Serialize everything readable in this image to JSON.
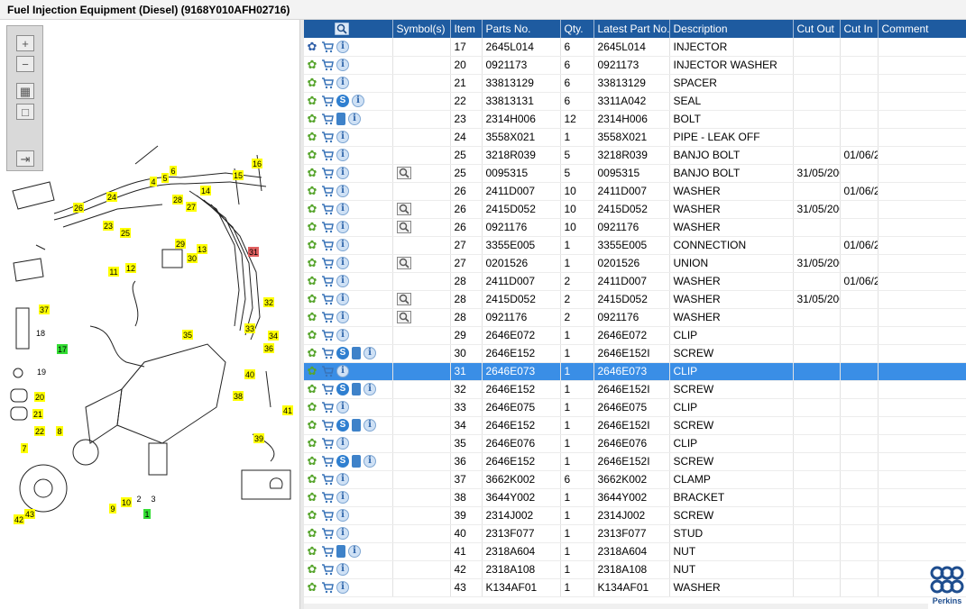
{
  "window": {
    "title": "Fuel Injection Equipment (Diesel) (9168Y010AFH02716)"
  },
  "toolbar": {
    "zoom_in_icon": "plus-icon",
    "zoom_out_icon": "minus-icon",
    "fit_icon": "grid-icon",
    "reset_icon": "square-icon",
    "export_icon": "export-icon"
  },
  "diagram": {
    "callouts": [
      {
        "label": "4"
      },
      {
        "label": "5"
      },
      {
        "label": "6"
      },
      {
        "label": "16"
      },
      {
        "label": "15"
      },
      {
        "label": "14"
      },
      {
        "label": "24"
      },
      {
        "label": "28"
      },
      {
        "label": "27"
      },
      {
        "label": "26"
      },
      {
        "label": "23"
      },
      {
        "label": "25"
      },
      {
        "label": "29"
      },
      {
        "label": "13"
      },
      {
        "label": "30"
      },
      {
        "label": "12"
      },
      {
        "label": "11"
      },
      {
        "label": "31"
      },
      {
        "label": "32"
      },
      {
        "label": "33"
      },
      {
        "label": "34"
      },
      {
        "label": "35"
      },
      {
        "label": "36"
      },
      {
        "label": "37"
      },
      {
        "label": "18"
      },
      {
        "label": "17"
      },
      {
        "label": "19"
      },
      {
        "label": "20"
      },
      {
        "label": "21"
      },
      {
        "label": "22"
      },
      {
        "label": "8"
      },
      {
        "label": "7"
      },
      {
        "label": "40"
      },
      {
        "label": "38"
      },
      {
        "label": "41"
      },
      {
        "label": "39"
      },
      {
        "label": "9"
      },
      {
        "label": "10"
      },
      {
        "label": "2"
      },
      {
        "label": "3"
      },
      {
        "label": "1"
      },
      {
        "label": "43"
      },
      {
        "label": "42"
      }
    ],
    "highlighted_callout": "31"
  },
  "grid": {
    "columns": [
      "",
      "Symbol(s)",
      "Item",
      "Parts No.",
      "Qty.",
      "Latest Part No.",
      "Description",
      "Cut Out",
      "Cut In",
      "Comment"
    ],
    "header_icon": "magnifier-icon",
    "rows": [
      {
        "icons": [
          "gear-blue",
          "cart",
          "info"
        ],
        "symbol": "",
        "item": "17",
        "part": "2645L014",
        "qty": "6",
        "latest": "2645L014",
        "desc": "INJECTOR",
        "cut_out": "",
        "cut_in": "",
        "comment": ""
      },
      {
        "icons": [
          "gear",
          "cart",
          "info"
        ],
        "symbol": "",
        "item": "20",
        "part": "0921173",
        "qty": "6",
        "latest": "0921173",
        "desc": "INJECTOR WASHER",
        "cut_out": "",
        "cut_in": "",
        "comment": ""
      },
      {
        "icons": [
          "gear",
          "cart",
          "info"
        ],
        "symbol": "",
        "item": "21",
        "part": "33813129",
        "qty": "6",
        "latest": "33813129",
        "desc": "SPACER",
        "cut_out": "",
        "cut_in": "",
        "comment": ""
      },
      {
        "icons": [
          "gear",
          "cart",
          "s",
          "info"
        ],
        "symbol": "",
        "item": "22",
        "part": "33813131",
        "qty": "6",
        "latest": "3311A042",
        "desc": "SEAL",
        "cut_out": "",
        "cut_in": "",
        "comment": ""
      },
      {
        "icons": [
          "gear",
          "cart",
          "book",
          "info"
        ],
        "symbol": "",
        "item": "23",
        "part": "2314H006",
        "qty": "12",
        "latest": "2314H006",
        "desc": "BOLT",
        "cut_out": "",
        "cut_in": "",
        "comment": ""
      },
      {
        "icons": [
          "gear",
          "cart",
          "info"
        ],
        "symbol": "",
        "item": "24",
        "part": "3558X021",
        "qty": "1",
        "latest": "3558X021",
        "desc": "PIPE - LEAK OFF",
        "cut_out": "",
        "cut_in": "",
        "comment": ""
      },
      {
        "icons": [
          "gear",
          "cart",
          "info"
        ],
        "symbol": "",
        "item": "25",
        "part": "3218R039",
        "qty": "5",
        "latest": "3218R039",
        "desc": "BANJO BOLT",
        "cut_out": "",
        "cut_in": "01/06/2",
        "comment": ""
      },
      {
        "icons": [
          "gear",
          "cart",
          "info"
        ],
        "symbol": "mag",
        "item": "25",
        "part": "0095315",
        "qty": "5",
        "latest": "0095315",
        "desc": "BANJO BOLT",
        "cut_out": "31/05/200",
        "cut_in": "",
        "comment": ""
      },
      {
        "icons": [
          "gear",
          "cart",
          "info"
        ],
        "symbol": "",
        "item": "26",
        "part": "2411D007",
        "qty": "10",
        "latest": "2411D007",
        "desc": "WASHER",
        "cut_out": "",
        "cut_in": "01/06/2",
        "comment": ""
      },
      {
        "icons": [
          "gear",
          "cart",
          "info"
        ],
        "symbol": "mag",
        "item": "26",
        "part": "2415D052",
        "qty": "10",
        "latest": "2415D052",
        "desc": "WASHER",
        "cut_out": "31/05/200",
        "cut_in": "",
        "comment": ""
      },
      {
        "icons": [
          "gear",
          "cart",
          "info"
        ],
        "symbol": "mag",
        "item": "26",
        "part": "0921176",
        "qty": "10",
        "latest": "0921176",
        "desc": "WASHER",
        "cut_out": "",
        "cut_in": "",
        "comment": ""
      },
      {
        "icons": [
          "gear",
          "cart",
          "info"
        ],
        "symbol": "",
        "item": "27",
        "part": "3355E005",
        "qty": "1",
        "latest": "3355E005",
        "desc": "CONNECTION",
        "cut_out": "",
        "cut_in": "01/06/2",
        "comment": ""
      },
      {
        "icons": [
          "gear",
          "cart",
          "info"
        ],
        "symbol": "mag",
        "item": "27",
        "part": "0201526",
        "qty": "1",
        "latest": "0201526",
        "desc": "UNION",
        "cut_out": "31/05/200",
        "cut_in": "",
        "comment": ""
      },
      {
        "icons": [
          "gear",
          "cart",
          "info"
        ],
        "symbol": "",
        "item": "28",
        "part": "2411D007",
        "qty": "2",
        "latest": "2411D007",
        "desc": "WASHER",
        "cut_out": "",
        "cut_in": "01/06/2",
        "comment": ""
      },
      {
        "icons": [
          "gear",
          "cart",
          "info"
        ],
        "symbol": "mag",
        "item": "28",
        "part": "2415D052",
        "qty": "2",
        "latest": "2415D052",
        "desc": "WASHER",
        "cut_out": "31/05/200",
        "cut_in": "",
        "comment": ""
      },
      {
        "icons": [
          "gear",
          "cart",
          "info"
        ],
        "symbol": "mag",
        "item": "28",
        "part": "0921176",
        "qty": "2",
        "latest": "0921176",
        "desc": "WASHER",
        "cut_out": "",
        "cut_in": "",
        "comment": ""
      },
      {
        "icons": [
          "gear",
          "cart",
          "info"
        ],
        "symbol": "",
        "item": "29",
        "part": "2646E072",
        "qty": "1",
        "latest": "2646E072",
        "desc": "CLIP",
        "cut_out": "",
        "cut_in": "",
        "comment": ""
      },
      {
        "icons": [
          "gear",
          "cart",
          "s",
          "book",
          "info"
        ],
        "symbol": "",
        "item": "30",
        "part": "2646E152",
        "qty": "1",
        "latest": "2646E152I",
        "desc": "SCREW",
        "cut_out": "",
        "cut_in": "",
        "comment": ""
      },
      {
        "icons": [
          "gear",
          "cart",
          "info"
        ],
        "symbol": "",
        "item": "31",
        "part": "2646E073",
        "qty": "1",
        "latest": "2646E073",
        "desc": "CLIP",
        "cut_out": "",
        "cut_in": "",
        "comment": "",
        "selected": true
      },
      {
        "icons": [
          "gear",
          "cart",
          "s",
          "book",
          "info"
        ],
        "symbol": "",
        "item": "32",
        "part": "2646E152",
        "qty": "1",
        "latest": "2646E152I",
        "desc": "SCREW",
        "cut_out": "",
        "cut_in": "",
        "comment": ""
      },
      {
        "icons": [
          "gear",
          "cart",
          "info"
        ],
        "symbol": "",
        "item": "33",
        "part": "2646E075",
        "qty": "1",
        "latest": "2646E075",
        "desc": "CLIP",
        "cut_out": "",
        "cut_in": "",
        "comment": ""
      },
      {
        "icons": [
          "gear",
          "cart",
          "s",
          "book",
          "info"
        ],
        "symbol": "",
        "item": "34",
        "part": "2646E152",
        "qty": "1",
        "latest": "2646E152I",
        "desc": "SCREW",
        "cut_out": "",
        "cut_in": "",
        "comment": ""
      },
      {
        "icons": [
          "gear",
          "cart",
          "info"
        ],
        "symbol": "",
        "item": "35",
        "part": "2646E076",
        "qty": "1",
        "latest": "2646E076",
        "desc": "CLIP",
        "cut_out": "",
        "cut_in": "",
        "comment": ""
      },
      {
        "icons": [
          "gear",
          "cart",
          "s",
          "book",
          "info"
        ],
        "symbol": "",
        "item": "36",
        "part": "2646E152",
        "qty": "1",
        "latest": "2646E152I",
        "desc": "SCREW",
        "cut_out": "",
        "cut_in": "",
        "comment": ""
      },
      {
        "icons": [
          "gear",
          "cart",
          "info"
        ],
        "symbol": "",
        "item": "37",
        "part": "3662K002",
        "qty": "6",
        "latest": "3662K002",
        "desc": "CLAMP",
        "cut_out": "",
        "cut_in": "",
        "comment": ""
      },
      {
        "icons": [
          "gear",
          "cart",
          "info"
        ],
        "symbol": "",
        "item": "38",
        "part": "3644Y002",
        "qty": "1",
        "latest": "3644Y002",
        "desc": "BRACKET",
        "cut_out": "",
        "cut_in": "",
        "comment": ""
      },
      {
        "icons": [
          "gear",
          "cart",
          "info"
        ],
        "symbol": "",
        "item": "39",
        "part": "2314J002",
        "qty": "1",
        "latest": "2314J002",
        "desc": "SCREW",
        "cut_out": "",
        "cut_in": "",
        "comment": ""
      },
      {
        "icons": [
          "gear",
          "cart",
          "info"
        ],
        "symbol": "",
        "item": "40",
        "part": "2313F077",
        "qty": "1",
        "latest": "2313F077",
        "desc": "STUD",
        "cut_out": "",
        "cut_in": "",
        "comment": ""
      },
      {
        "icons": [
          "gear",
          "cart",
          "book",
          "info"
        ],
        "symbol": "",
        "item": "41",
        "part": "2318A604",
        "qty": "1",
        "latest": "2318A604",
        "desc": "NUT",
        "cut_out": "",
        "cut_in": "",
        "comment": ""
      },
      {
        "icons": [
          "gear",
          "cart",
          "info"
        ],
        "symbol": "",
        "item": "42",
        "part": "2318A108",
        "qty": "1",
        "latest": "2318A108",
        "desc": "NUT",
        "cut_out": "",
        "cut_in": "",
        "comment": ""
      },
      {
        "icons": [
          "gear",
          "cart",
          "info"
        ],
        "symbol": "",
        "item": "43",
        "part": "K134AF01",
        "qty": "1",
        "latest": "K134AF01",
        "desc": "WASHER",
        "cut_out": "",
        "cut_in": "",
        "comment": ""
      }
    ]
  },
  "brand": {
    "name": "Perkins",
    "color": "#1f4e8f"
  },
  "colors": {
    "header": "#1e5ba0",
    "selected_row": "#3a8ee6",
    "callout": "#ffff00",
    "callout_highlight": "#e06060",
    "callout_green": "#33dd33"
  }
}
